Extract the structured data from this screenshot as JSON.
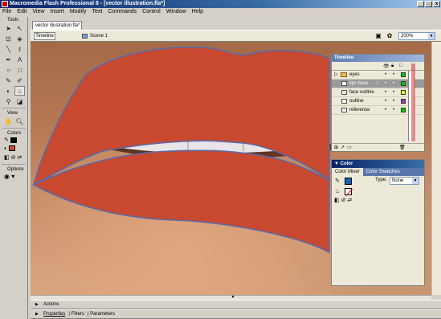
{
  "window": {
    "title": "Macromedia Flash Professional 8 - [vector illustration.fla*]",
    "buttons": [
      "_",
      "□",
      "x"
    ]
  },
  "menubar": [
    "File",
    "Edit",
    "View",
    "Insert",
    "Modify",
    "Text",
    "Commands",
    "Control",
    "Window",
    "Help"
  ],
  "toolbox": {
    "tools_label": "Tools",
    "view_label": "View",
    "colors_label": "Colors",
    "options_label": "Options",
    "stroke_color": "#000000",
    "fill_color": "#c8492f"
  },
  "document": {
    "tab": "vector illustration.fla*",
    "timeline_button": "Timeline",
    "scene": "Scene 1",
    "zoom": "200%"
  },
  "artwork": {
    "lip_color": "#c8492f",
    "outline_color": "#5a6aa8",
    "teeth_color": "#e9e4e8"
  },
  "timeline_panel": {
    "title": "Timeline",
    "layers": [
      {
        "name": "eyes",
        "type": "folder",
        "color": "#00cc00"
      },
      {
        "name": "lips base",
        "type": "layer",
        "color": "#00cc00",
        "selected": true
      },
      {
        "name": "face outline",
        "type": "layer",
        "color": "#ffff00"
      },
      {
        "name": "outline",
        "type": "layer",
        "color": "#9933cc"
      },
      {
        "name": "reference",
        "type": "layer",
        "color": "#00cc00"
      }
    ]
  },
  "color_panel": {
    "title": "Color",
    "tabs": [
      "Color Mixer",
      "Color Swatches"
    ],
    "type_label": "Type:",
    "type_value": "None"
  },
  "bottom_panels": {
    "actions": "Actions",
    "tabs": [
      "Properties",
      "Filters",
      "Parameters"
    ]
  }
}
